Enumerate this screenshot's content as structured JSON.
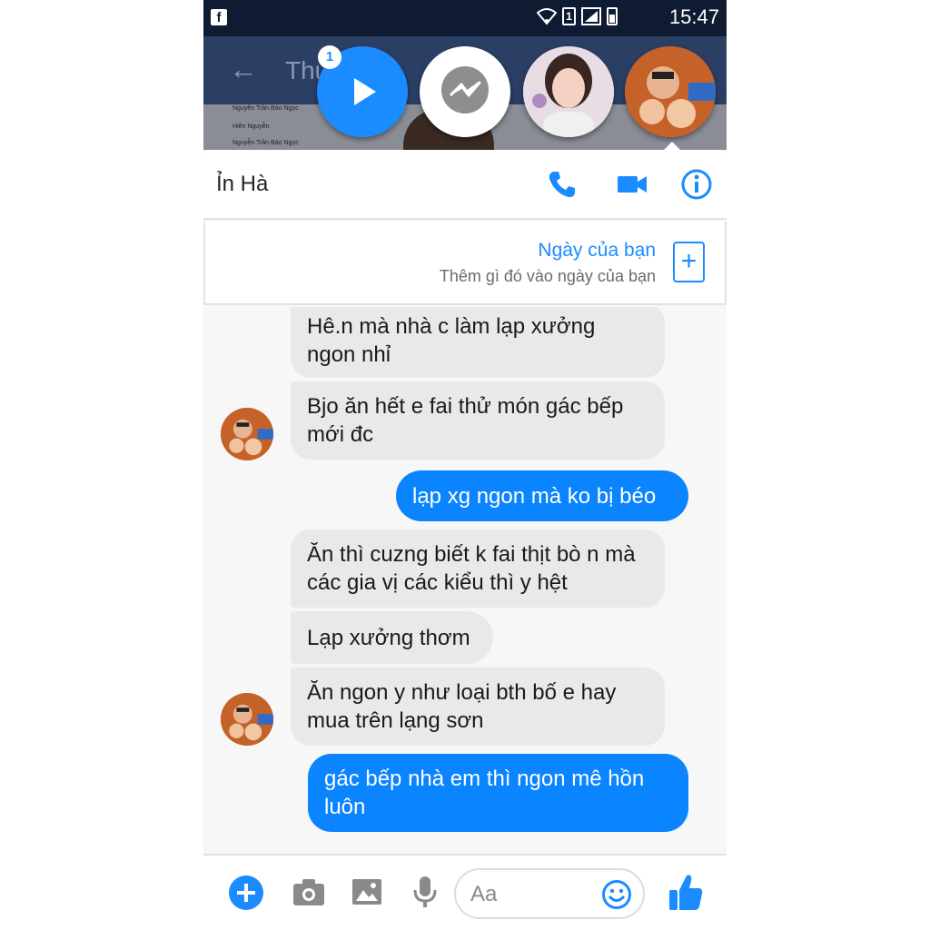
{
  "status_bar": {
    "app_notif": "f",
    "sim": "1",
    "clock": "15:47"
  },
  "background_app": {
    "back": "←",
    "title": "Thư",
    "rows": [
      "Nguyễn Trần Bảo Ngọc",
      "Hiền Nguyễn",
      "Nguyễn Trần Bảo Ngọc"
    ]
  },
  "chat_heads": {
    "badge_count": "1"
  },
  "chat": {
    "contact_name": "Ỉn Hà",
    "day": {
      "title": "Ngày của bạn",
      "subtitle": "Thêm gì đó vào ngày của bạn",
      "add": "+"
    },
    "messages": [
      {
        "dir": "in",
        "text": "Hê.n mà nhà c làm lạp xưởng ngon nhỉ"
      },
      {
        "dir": "in",
        "text": "Bjo ăn hết e fai thử món gác bếp mới đc"
      },
      {
        "dir": "out",
        "text": "lạp xg ngon mà ko bị béo"
      },
      {
        "dir": "in",
        "text": "Ăn thì cuzng biết k fai thịt bò n mà các gia vị các kiểu thì y hệt"
      },
      {
        "dir": "in",
        "text": "Lạp xưởng thơm"
      },
      {
        "dir": "in",
        "text": "Ăn ngon y như loại bth bố e hay mua trên lạng sơn"
      },
      {
        "dir": "out",
        "text": "gác bếp nhà em thì ngon mê hồn luôn"
      }
    ],
    "composer": {
      "placeholder": "Aa"
    }
  },
  "colors": {
    "accent": "#0a84ff",
    "incoming_bubble": "#e9e9eb",
    "status_bar": "#0f1a33"
  },
  "icons": [
    "play-icon",
    "messenger-icon",
    "phone-icon",
    "video-camera-icon",
    "info-icon",
    "plus-icon",
    "camera-icon",
    "image-icon",
    "microphone-icon",
    "emoji-icon",
    "thumbs-up-icon"
  ]
}
